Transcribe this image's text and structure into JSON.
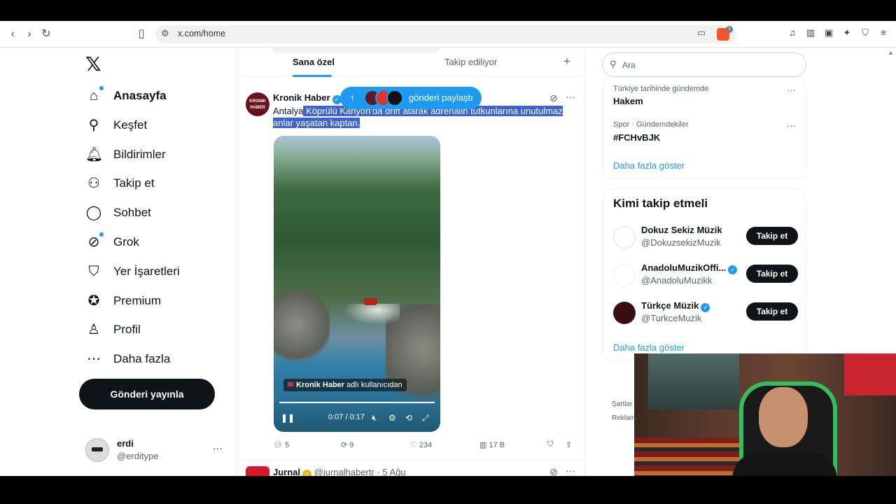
{
  "browser": {
    "url": "x.com/home",
    "brave_badge": "1"
  },
  "nav": {
    "items": [
      {
        "label": "Anasayfa",
        "icon": "home-icon"
      },
      {
        "label": "Keşfet",
        "icon": "search-icon"
      },
      {
        "label": "Bildirimler",
        "icon": "bell-icon"
      },
      {
        "label": "Takip et",
        "icon": "add-person-icon"
      },
      {
        "label": "Sohbet",
        "icon": "chat-icon"
      },
      {
        "label": "Grok",
        "icon": "grok-icon"
      },
      {
        "label": "Yer İşaretleri",
        "icon": "bookmark-icon"
      },
      {
        "label": "Premium",
        "icon": "premium-icon"
      },
      {
        "label": "Profil",
        "icon": "person-icon"
      },
      {
        "label": "Daha fazla",
        "icon": "more-circle-icon"
      }
    ],
    "post_button": "Gönderi yayınla",
    "user": {
      "name": "erdi",
      "handle": "@erditype"
    }
  },
  "feed": {
    "tabs": [
      "Sana özel",
      "Takip ediliyor"
    ],
    "share_pill": "gönderi paylaştı",
    "tweet": {
      "author": "Kronik Haber",
      "avatar_text": "KRONIK HABER",
      "text_plain": "Antalya",
      "text_selected_1": " Köprülü Kanyon'da drift atarak adrenalin tutkunlarına unutulmaz",
      "text_selected_2": "anlar yaşatan kaptan.",
      "video_credit_name": "Kronik Haber",
      "video_credit_suffix": " adlı kullanıcıdan",
      "video_time": "0:07 / 0:17",
      "replies": "5",
      "reposts": "9",
      "likes": "234",
      "views": "17 B"
    },
    "tweet2": {
      "author": "Jurnal",
      "handle": "@jurnalhabertr",
      "date": "· 5 Ağu"
    }
  },
  "right": {
    "search_placeholder": "Ara",
    "trends": [
      {
        "category": "Türkiye tarihinde gündemde",
        "name": "Hakem"
      },
      {
        "category": "Spor · Gündemdekiler",
        "name": "#FCHvBJK"
      }
    ],
    "show_more": "Daha fazla göster",
    "who_to_follow_title": "Kimi takip etmeli",
    "follow": [
      {
        "name": "Dokuz Sekiz Müzik",
        "handle": "@DokuzsekizMuzik",
        "button": "Takip et"
      },
      {
        "name": "AnadoluMuzikOffi...",
        "handle": "@AnadoluMuzikk",
        "button": "Takip et"
      },
      {
        "name": "Türkçe Müzik",
        "handle": "@TurkceMuzik",
        "button": "Takip et"
      }
    ],
    "show_more_2": "Daha fazla göster",
    "footer": [
      "Şartlar",
      "Reklam"
    ]
  },
  "colors": {
    "accent": "#1d9bf0",
    "text": "#0f1419",
    "muted": "#536471",
    "selection": "#3b64d0"
  }
}
